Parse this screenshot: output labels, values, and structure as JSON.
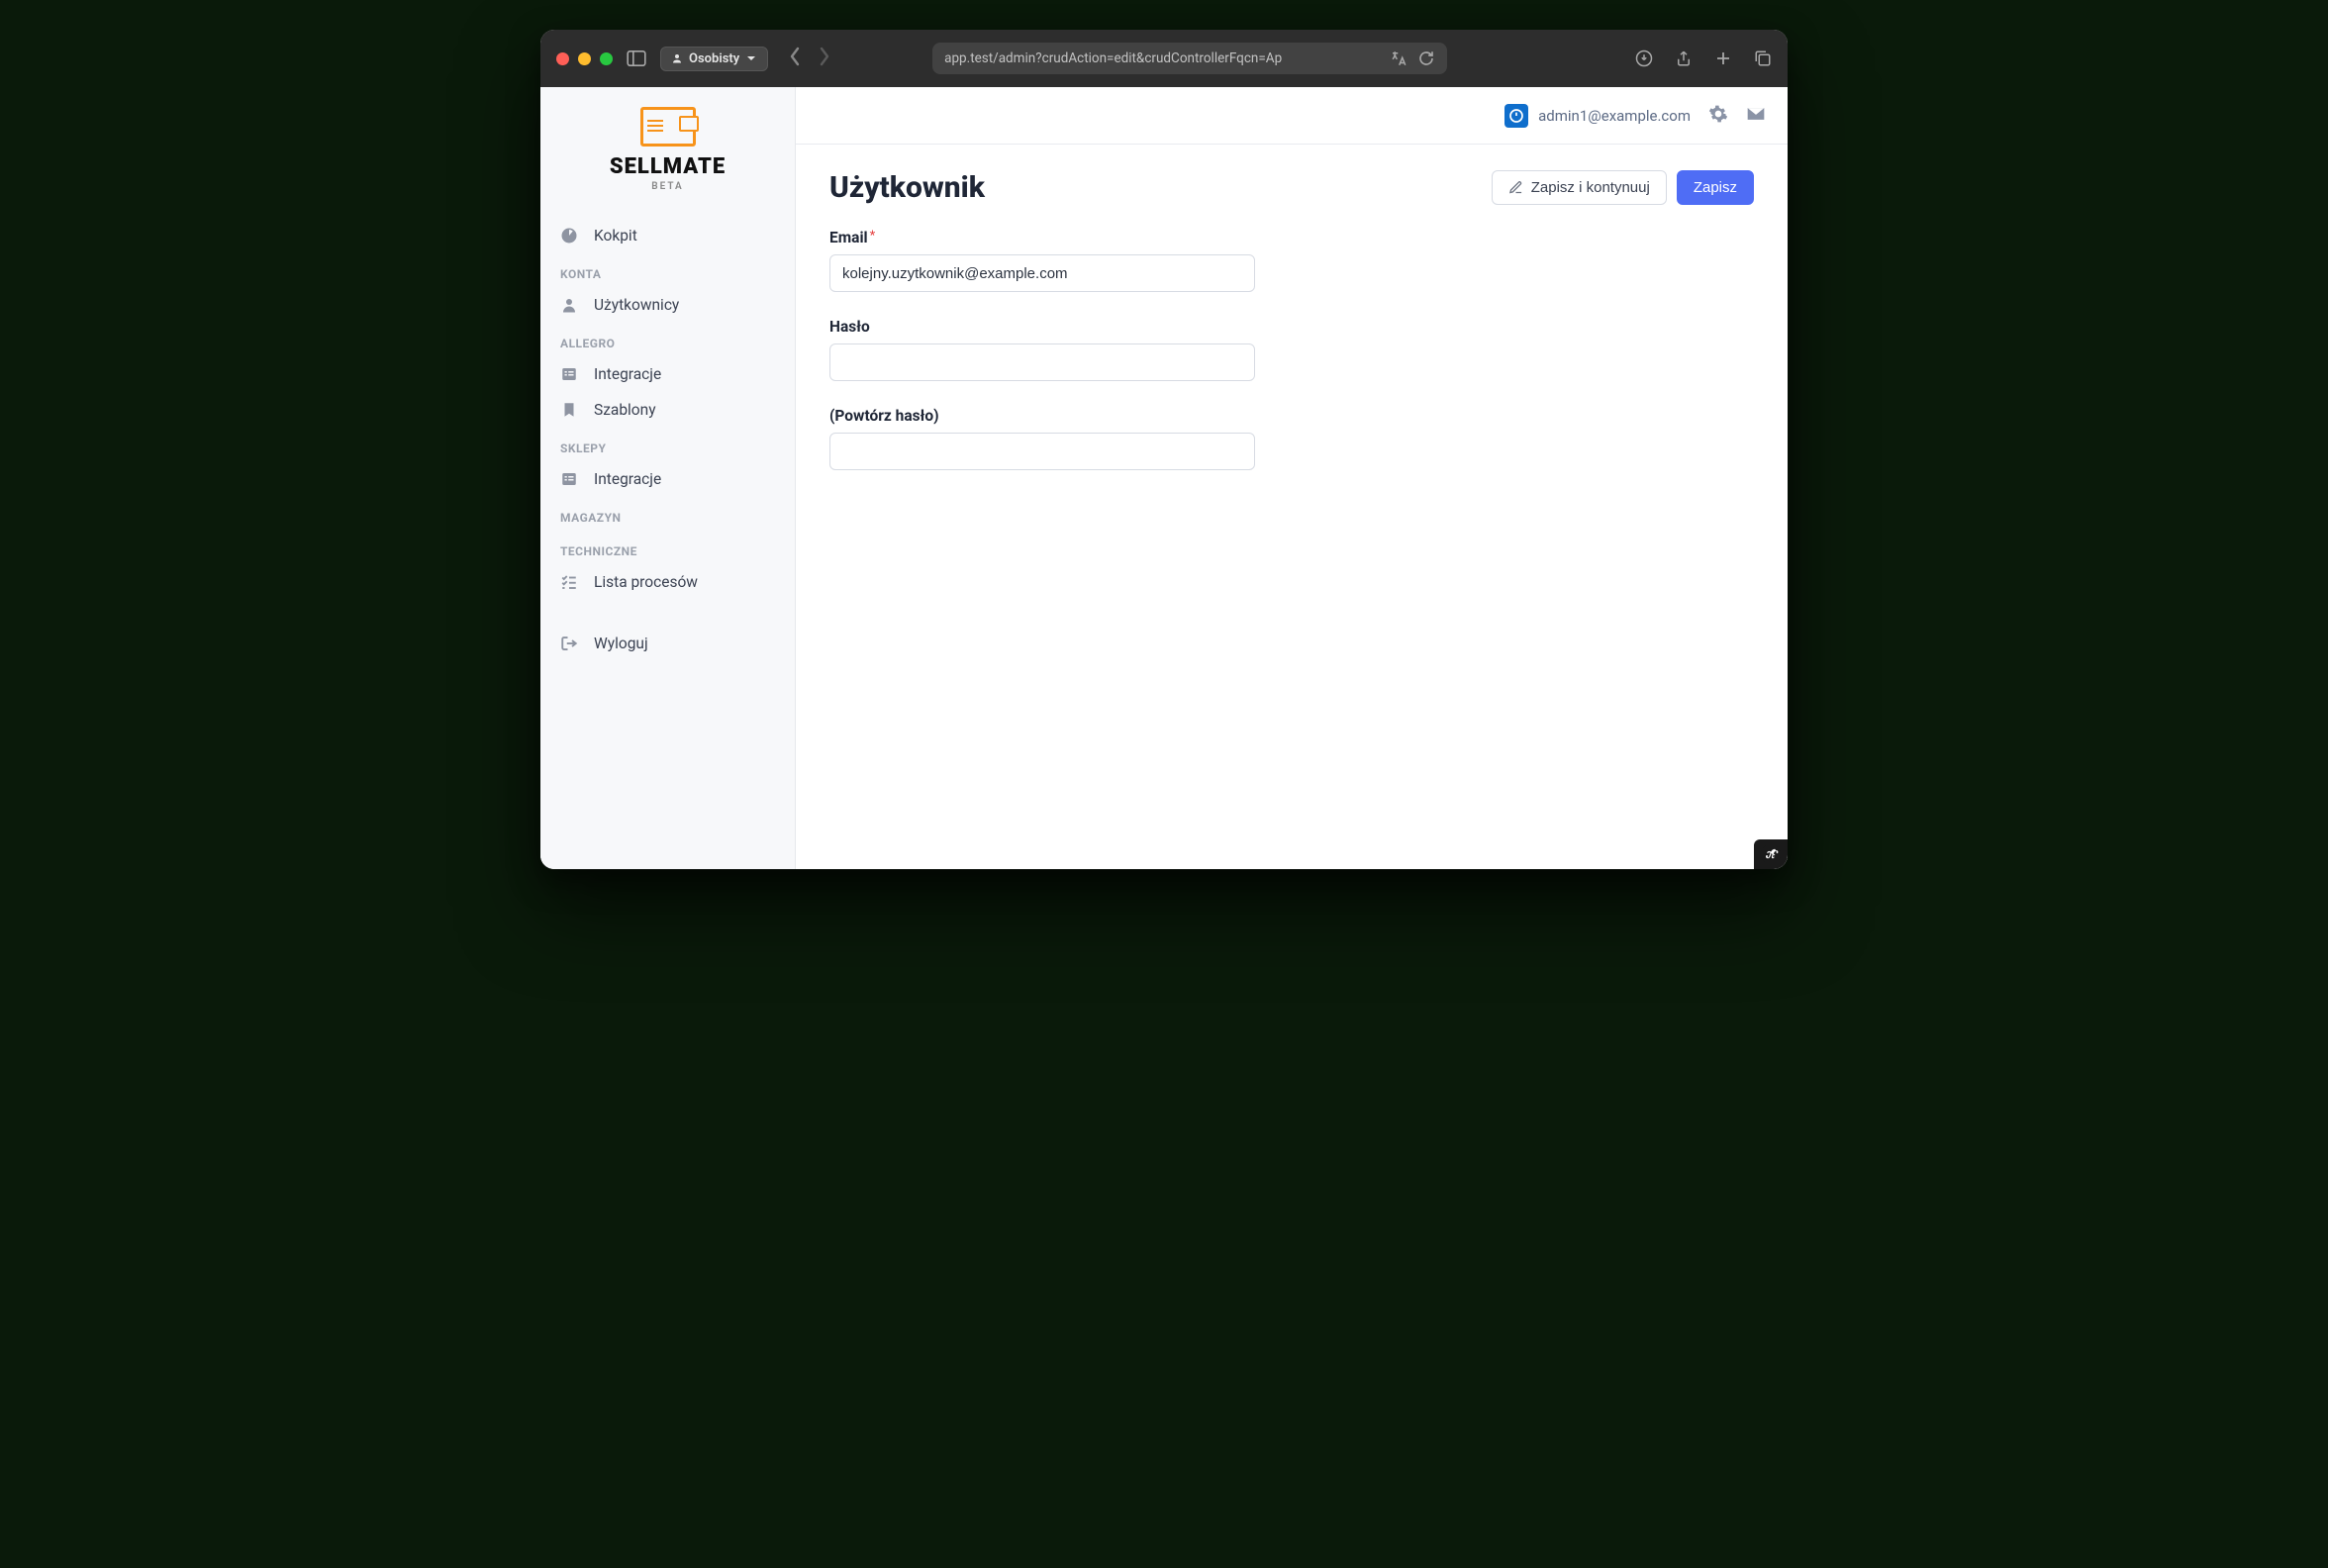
{
  "browser": {
    "profile_label": "Osobisty",
    "url": "app.test/admin?crudAction=edit&crudControllerFqcn=Ap"
  },
  "branding": {
    "name": "SELLMATE",
    "subtitle": "BETA"
  },
  "sidebar": {
    "item_dashboard": "Kokpit",
    "section_accounts": "KONTA",
    "item_users": "Użytkownicy",
    "section_allegro": "ALLEGRO",
    "item_integrations_allegro": "Integracje",
    "item_templates": "Szablony",
    "section_shops": "SKLEPY",
    "item_integrations_shops": "Integracje",
    "section_warehouse": "MAGAZYN",
    "section_technical": "TECHNICZNE",
    "item_process_list": "Lista procesów",
    "item_logout": "Wyloguj"
  },
  "header": {
    "user_email": "admin1@example.com"
  },
  "page": {
    "title": "Użytkownik",
    "save_continue_label": "Zapisz i kontynuuj",
    "save_label": "Zapisz"
  },
  "form": {
    "email_label": "Email",
    "email_value": "kolejny.uzytkownik@example.com",
    "password_label": "Hasło",
    "password_value": "",
    "password_repeat_label": "(Powtórz hasło)",
    "password_repeat_value": ""
  }
}
